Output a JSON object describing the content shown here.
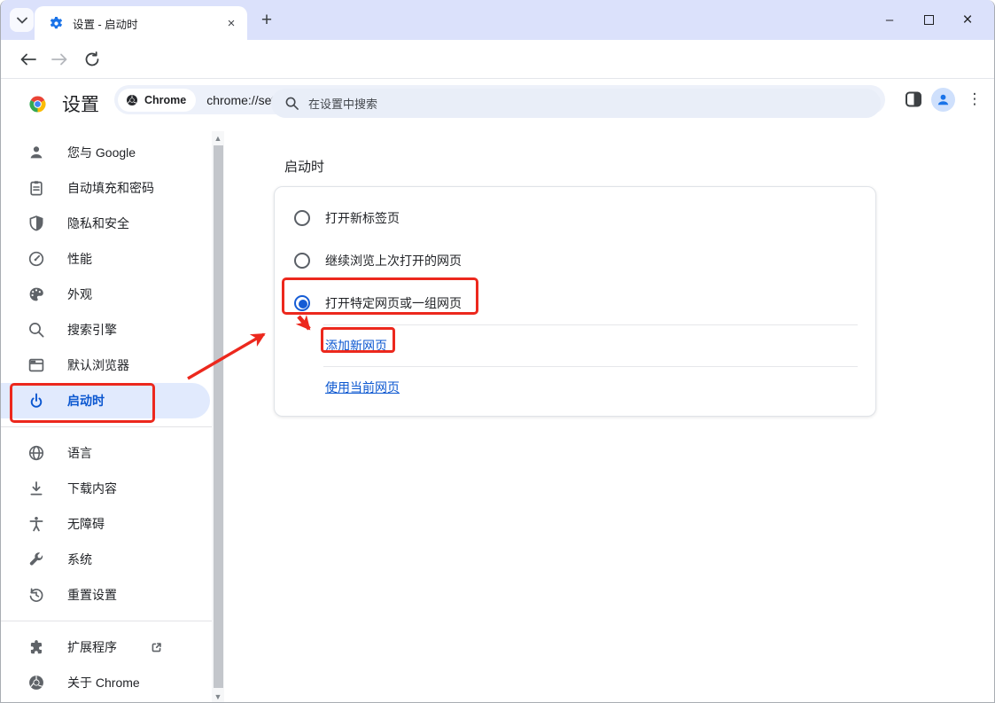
{
  "window_controls": {
    "minimize_glyph": "–",
    "close_glyph": "×"
  },
  "tabstrip": {
    "tab_title": "设置 - 启动时",
    "tab_close_glyph": "×",
    "new_tab_glyph": "+"
  },
  "toolbar": {
    "site_chip_label": "Chrome",
    "url": "chrome://settings/onStartup",
    "star_glyph": "☆",
    "menu_glyph": "⋮"
  },
  "header": {
    "page_title": "设置",
    "search_placeholder": "在设置中搜索"
  },
  "sidebar": {
    "items": [
      {
        "label": "您与 Google",
        "icon": "person-icon"
      },
      {
        "label": "自动填充和密码",
        "icon": "autofill-icon"
      },
      {
        "label": "隐私和安全",
        "icon": "shield-icon"
      },
      {
        "label": "性能",
        "icon": "speedometer-icon"
      },
      {
        "label": "外观",
        "icon": "palette-icon"
      },
      {
        "label": "搜索引擎",
        "icon": "search-icon"
      },
      {
        "label": "默认浏览器",
        "icon": "browser-icon"
      },
      {
        "label": "启动时",
        "icon": "power-icon",
        "selected": true
      },
      {
        "label": "语言",
        "icon": "globe-icon"
      },
      {
        "label": "下载内容",
        "icon": "download-icon"
      },
      {
        "label": "无障碍",
        "icon": "accessibility-icon"
      },
      {
        "label": "系统",
        "icon": "wrench-icon"
      },
      {
        "label": "重置设置",
        "icon": "reset-icon"
      },
      {
        "label": "扩展程序",
        "icon": "puzzle-icon",
        "external_link": true
      },
      {
        "label": "关于 Chrome",
        "icon": "chrome-mono-icon"
      }
    ]
  },
  "startup": {
    "section_title": "启动时",
    "options": [
      {
        "label": "打开新标签页",
        "selected": false
      },
      {
        "label": "继续浏览上次打开的网页",
        "selected": false
      },
      {
        "label": "打开特定网页或一组网页",
        "selected": true
      }
    ],
    "actions": [
      {
        "label": "添加新网页"
      },
      {
        "label": "使用当前网页"
      }
    ]
  },
  "colors": {
    "accent_blue": "#0b57d0",
    "selected_pill_bg": "#e1eafd",
    "annotation_red": "#ec281d",
    "tabstrip_bg": "#dbe1fb",
    "omnibox_bg": "#edf1fa"
  }
}
